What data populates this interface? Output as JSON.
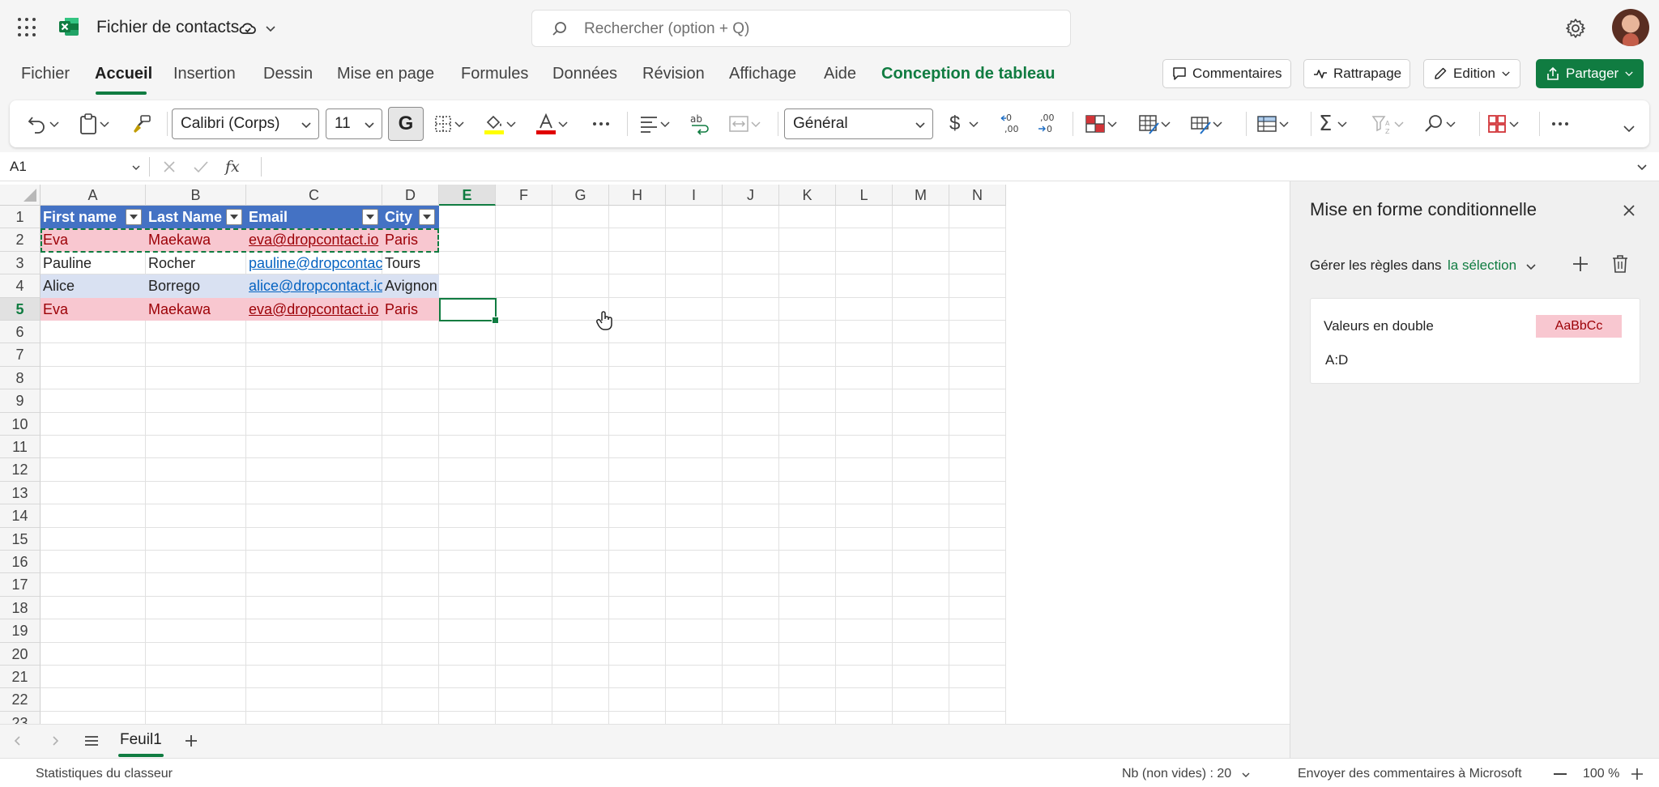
{
  "app": {
    "doc_title": "Fichier de contacts",
    "search_placeholder": "Rechercher (option + Q)"
  },
  "ribbon": {
    "tabs": [
      "Fichier",
      "Accueil",
      "Insertion",
      "Dessin",
      "Mise en page",
      "Formules",
      "Données",
      "Révision",
      "Affichage",
      "Aide",
      "Conception de tableau"
    ],
    "active_tab": "Accueil",
    "buttons": {
      "comments": "Commentaires",
      "catchup": "Rattrapage",
      "edition": "Edition",
      "share": "Partager"
    }
  },
  "toolbar": {
    "font": "Calibri (Corps)",
    "font_size": "11",
    "bold": "G",
    "number_format": "Général",
    "increase_decimal": "←0\n,00",
    "decrease_decimal": ",00\n→0"
  },
  "formula_bar": {
    "name_box": "A1",
    "fx": "fx",
    "content": ""
  },
  "grid": {
    "columns": [
      "A",
      "B",
      "C",
      "D",
      "E",
      "F",
      "G",
      "H",
      "I",
      "J",
      "K",
      "L",
      "M",
      "N"
    ],
    "rows": [
      "1",
      "2",
      "3",
      "4",
      "5",
      "6",
      "7",
      "8",
      "9",
      "10",
      "11",
      "12",
      "13",
      "14",
      "15",
      "16",
      "17",
      "18",
      "19",
      "20",
      "21",
      "22",
      "23"
    ],
    "selected_column": "E",
    "selected_row": "5",
    "table": {
      "headers": [
        "First name",
        "Last Name",
        "Email",
        "City"
      ],
      "rows": [
        [
          "Eva",
          "Maekawa",
          "eva@dropcontact.io",
          "Paris"
        ],
        [
          "Pauline",
          "Rocher",
          "pauline@dropcontact.io",
          "Tours"
        ],
        [
          "Alice",
          "Borrego",
          "alice@dropcontact.io",
          "Avignon"
        ],
        [
          "Eva",
          "Maekawa",
          "eva@dropcontact.io",
          "Paris"
        ]
      ],
      "duplicate_rows": [
        0,
        3
      ],
      "header_color": "#4472c4",
      "band_color": "#d9e1f2",
      "duplicate_fill": "#f8c7d0",
      "duplicate_text": "#9c0006"
    }
  },
  "sheets": {
    "tabs": [
      "Feuil1"
    ],
    "active": "Feuil1"
  },
  "panel": {
    "title": "Mise en forme conditionnelle",
    "manage_label": "Gérer les règles dans",
    "scope": "la sélection",
    "rule": {
      "name": "Valeurs en double",
      "range": "A:D",
      "preview": "AaBbCc"
    }
  },
  "status": {
    "stats": "Statistiques du classeur",
    "count": "Nb (non vides) : 20",
    "feedback": "Envoyer des commentaires à Microsoft",
    "zoom": "100 %"
  },
  "colors": {
    "accent": "#107c41"
  }
}
